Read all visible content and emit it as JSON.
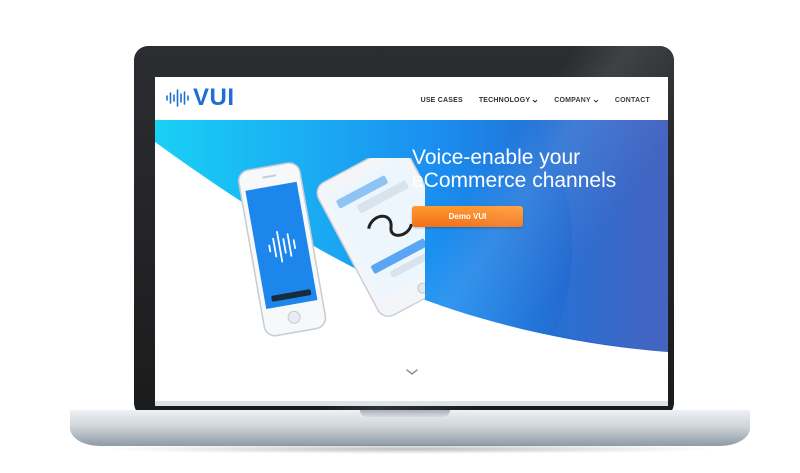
{
  "brand": {
    "name": "VUI",
    "color": "#1e6fd0"
  },
  "nav": {
    "items": [
      {
        "label": "USE CASES",
        "has_dropdown": false
      },
      {
        "label": "TECHNOLOGY",
        "has_dropdown": true
      },
      {
        "label": "COMPANY",
        "has_dropdown": true
      },
      {
        "label": "CONTACT",
        "has_dropdown": false
      }
    ]
  },
  "hero": {
    "headline_line1": "Voice-enable your",
    "headline_line2": "eCommerce channels",
    "cta_label": "Demo VUI",
    "cta_color": "#f2701a",
    "gradient_colors": [
      "#19d0f5",
      "#1a8ef0",
      "#2d4fb8"
    ]
  },
  "icons": {
    "logo": "voice-waveform-icon",
    "dropdown": "chevron-down-icon",
    "scroll": "chevron-down-icon"
  }
}
